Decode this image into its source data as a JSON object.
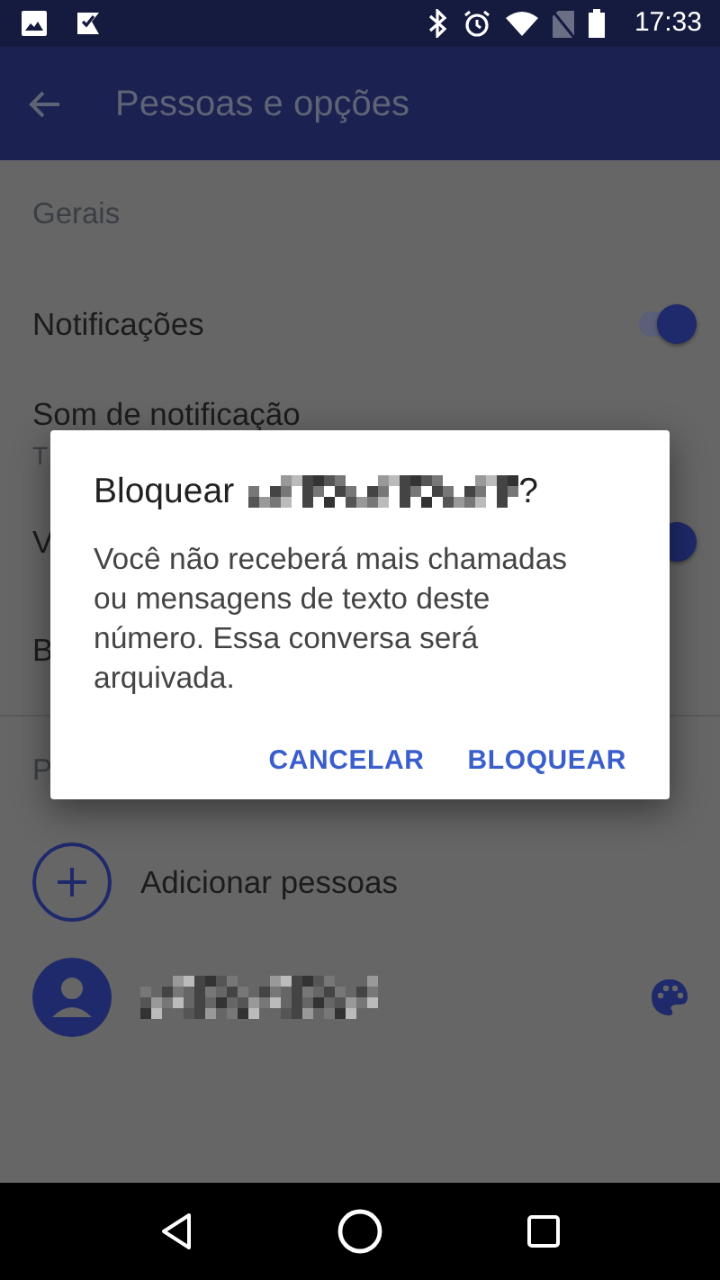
{
  "status_bar": {
    "time": "17:33"
  },
  "app_bar": {
    "title": "Pessoas e opções"
  },
  "sections": [
    {
      "header": "Gerais",
      "items": [
        {
          "kind": "switch",
          "title": "Notificações",
          "on": true
        },
        {
          "kind": "text",
          "title": "Som de notificação",
          "subtitle": "T"
        },
        {
          "kind": "switch",
          "title": "V",
          "on": true
        },
        {
          "kind": "text",
          "title": "B"
        }
      ]
    },
    {
      "header": "P",
      "items": [
        {
          "kind": "add",
          "title": "Adicionar pessoas"
        },
        {
          "kind": "contact"
        }
      ]
    }
  ],
  "dialog": {
    "title_start": "Bloquear",
    "title_end": "?",
    "message": "Você não receberá mais chamadas ou mensagens de texto deste número. Essa conversa será arquivada.",
    "buttons": [
      "CANCELAR",
      "BLOQUEAR"
    ]
  }
}
